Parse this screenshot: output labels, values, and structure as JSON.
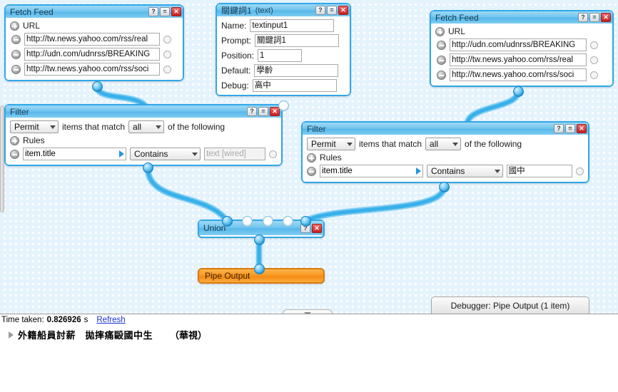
{
  "canvas": {
    "modules": {
      "fetch_feed_left": {
        "title": "Fetch Feed",
        "section_label": "URL",
        "urls": [
          "http://tw.news.yahoo.com/rss/real",
          "http://udn.com/udnrss/BREAKING",
          "http://tw.news.yahoo.com/rss/soci"
        ]
      },
      "text_input": {
        "title": "關鍵詞1",
        "subtitle": "(text)",
        "fields": [
          {
            "label": "Name:",
            "value": "textinput1"
          },
          {
            "label": "Prompt:",
            "value": "關鍵詞1"
          },
          {
            "label": "Position:",
            "value": "1"
          },
          {
            "label": "Default:",
            "value": "學齡"
          },
          {
            "label": "Debug:",
            "value": "高中"
          }
        ]
      },
      "fetch_feed_right": {
        "title": "Fetch Feed",
        "section_label": "URL",
        "urls": [
          "http://udn.com/udnrss/BREAKING",
          "http://tw.news.yahoo.com/rss/real",
          "http://tw.news.yahoo.com/rss/soci"
        ]
      },
      "filter_left": {
        "title": "Filter",
        "permit": "Permit",
        "mid_text": "items that match",
        "match": "all",
        "tail_text": "of the following",
        "rules_label": "Rules",
        "rule": {
          "field": "item.title",
          "operator": "Contains",
          "value": "",
          "value_placeholder": "text [wired]"
        }
      },
      "filter_right": {
        "title": "Filter",
        "permit": "Permit",
        "mid_text": "items that match",
        "match": "all",
        "tail_text": "of the following",
        "rules_label": "Rules",
        "rule": {
          "field": "item.title",
          "operator": "Contains",
          "value": "國中",
          "value_placeholder": ""
        }
      },
      "union": {
        "title": "Union"
      },
      "pipe_output": {
        "title": "Pipe Output"
      }
    },
    "window_buttons": {
      "help": "?",
      "minimize": "=",
      "close": "✕"
    }
  },
  "debugger": {
    "tab_label": "Debugger: Pipe Output (1 item)",
    "status": {
      "time_label": "Time taken:",
      "time_value": "0.826926",
      "time_unit": "s",
      "refresh_label": "Refresh"
    },
    "results": [
      {
        "title": "外籍船員討薪　拋摔痛毆國中生",
        "source": "（華視）"
      }
    ]
  }
}
